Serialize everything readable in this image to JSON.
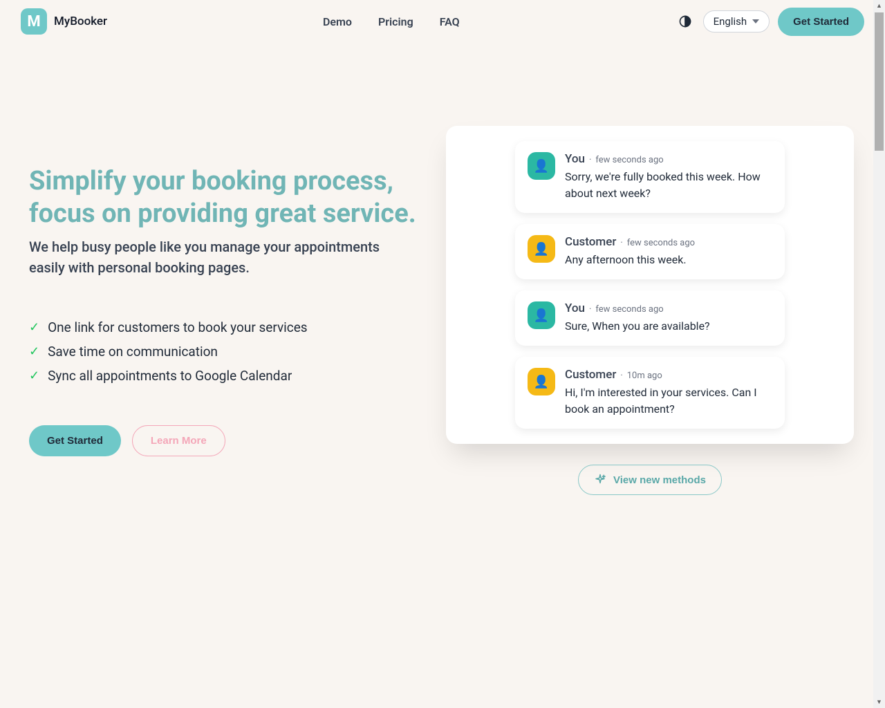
{
  "brand": {
    "logo_letter": "M",
    "name": "MyBooker"
  },
  "nav": {
    "items": [
      {
        "label": "Demo"
      },
      {
        "label": "Pricing"
      },
      {
        "label": "FAQ"
      }
    ]
  },
  "header": {
    "language": "English",
    "cta": "Get Started"
  },
  "hero": {
    "headline": "Simplify your booking process, focus on providing great service.",
    "subhead": "We help busy people like you manage your appointments easily with personal booking pages.",
    "features": [
      "One link for customers to book your services",
      "Save time on communication",
      "Sync all appointments to Google Calendar"
    ],
    "primary_cta": "Get Started",
    "secondary_cta": "Learn More",
    "view_methods": "View new methods"
  },
  "chat": [
    {
      "sender": "You",
      "time": "few seconds ago",
      "text": "Sorry, we're fully booked this week. How about next week?",
      "avatar": "you"
    },
    {
      "sender": "Customer",
      "time": "few seconds ago",
      "text": "Any afternoon this week.",
      "avatar": "customer"
    },
    {
      "sender": "You",
      "time": "few seconds ago",
      "text": "Sure, When you are available?",
      "avatar": "you"
    },
    {
      "sender": "Customer",
      "time": "10m ago",
      "text": "Hi, I'm interested in your services. Can I book an appointment?",
      "avatar": "customer"
    }
  ]
}
